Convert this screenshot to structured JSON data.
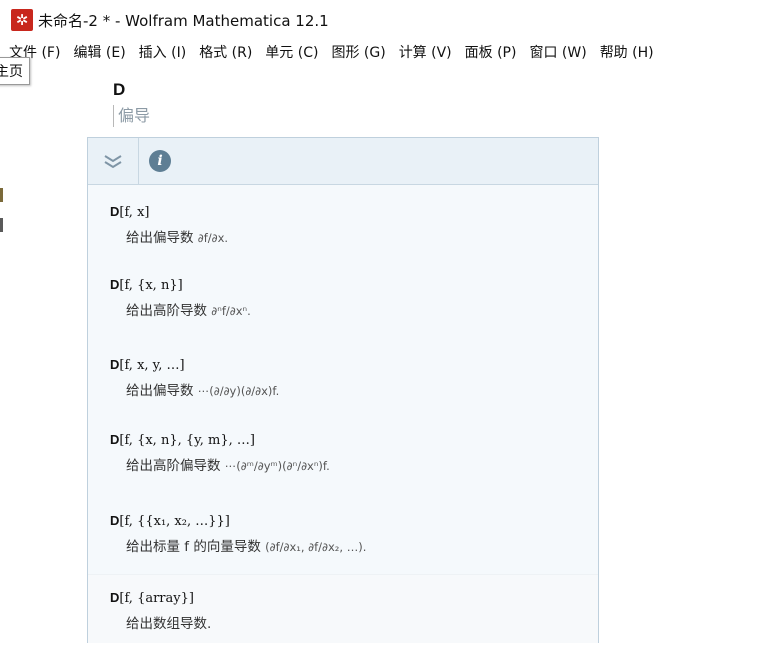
{
  "window": {
    "title": "未命名-2 * - Wolfram Mathematica 12.1",
    "app_icon": "mathematica-spikey-icon"
  },
  "menu": [
    {
      "label": "文件 (F)"
    },
    {
      "label": "编辑 (E)"
    },
    {
      "label": "插入 (I)"
    },
    {
      "label": "格式 (R)"
    },
    {
      "label": "单元 (C)"
    },
    {
      "label": "图形 (G)"
    },
    {
      "label": "计算 (V)"
    },
    {
      "label": "面板 (P)"
    },
    {
      "label": "窗口 (W)"
    },
    {
      "label": "帮助 (H)"
    }
  ],
  "tooltip": {
    "text": "主页"
  },
  "doc": {
    "title": "D",
    "subtitle": "偏导"
  },
  "panel": {
    "collapse_icon": "double-chevron-down-icon",
    "info_icon": "info-icon",
    "info_glyph": "i",
    "entries": [
      {
        "usage": "D[f, x]",
        "desc": "给出偏导数",
        "math": "∂f/∂x."
      },
      {
        "usage": "D[f, {x, n}]",
        "desc": "给出高阶导数",
        "math": "∂ⁿf/∂xⁿ."
      },
      {
        "usage": "D[f, x, y, …]",
        "desc": "给出偏导数",
        "math": "⋯(∂/∂y)(∂/∂x)f."
      },
      {
        "usage": "D[f, {x, n}, {y, m}, …]",
        "desc": "给出高阶偏导数",
        "math": "⋯(∂ᵐ/∂yᵐ)(∂ⁿ/∂xⁿ)f."
      },
      {
        "usage": "D[f, {{x₁, x₂, …}}]",
        "desc": "给出标量 f 的向量导数",
        "math": "(∂f/∂x₁, ∂f/∂x₂, …)."
      },
      {
        "usage": "D[f, {array}]",
        "desc": "给出数组导数.",
        "math": ""
      }
    ]
  },
  "colors": {
    "app_icon": "#c8271d",
    "panel_border": "#bfd0dd",
    "panel_header": "#e9f1f7",
    "info_icon": "#5e7e94",
    "subtitle": "#8c9aa5"
  }
}
